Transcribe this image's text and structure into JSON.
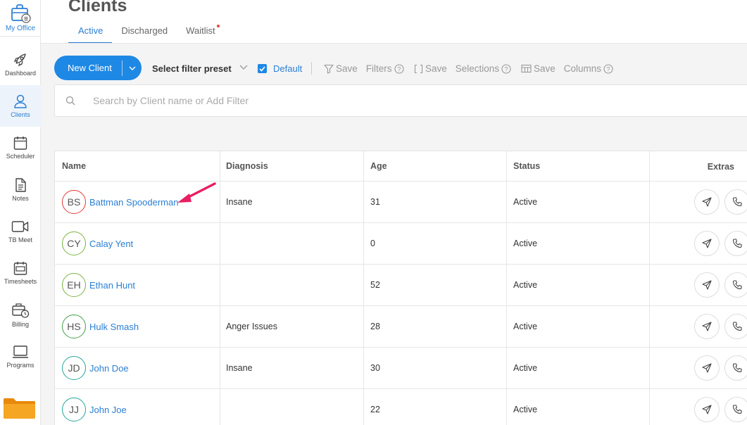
{
  "sidebar": {
    "office_label": "My Office",
    "items": [
      {
        "label": "Dashboard",
        "icon": "rocket-icon"
      },
      {
        "label": "Clients",
        "icon": "user-icon"
      },
      {
        "label": "Scheduler",
        "icon": "calendar-icon"
      },
      {
        "label": "Notes",
        "icon": "notes-icon"
      },
      {
        "label": "TB Meet",
        "icon": "video-icon"
      },
      {
        "label": "Timesheets",
        "icon": "timesheet-icon"
      },
      {
        "label": "Billing",
        "icon": "billing-icon"
      },
      {
        "label": "Programs",
        "icon": "monitor-icon"
      }
    ]
  },
  "header": {
    "title": "Clients",
    "tabs": [
      {
        "label": "Active"
      },
      {
        "label": "Discharged"
      },
      {
        "label": "Waitlist"
      }
    ]
  },
  "toolbar": {
    "new_client_label": "New Client",
    "preset_label": "Select filter preset",
    "default_label": "Default",
    "save_filters": {
      "save": "Save",
      "label": "Filters"
    },
    "save_selections": {
      "save": "Save",
      "label": "Selections"
    },
    "save_columns": {
      "save": "Save",
      "label": "Columns"
    }
  },
  "search": {
    "placeholder": "Search by Client name or Add Filter"
  },
  "table": {
    "headers": {
      "name": "Name",
      "diagnosis": "Diagnosis",
      "age": "Age",
      "status": "Status",
      "extras": "Extras"
    },
    "rows": [
      {
        "initials": "BS",
        "name": "Battman Spooderman",
        "diagnosis": "Insane",
        "age": "31",
        "status": "Active",
        "avatar_color": "#e53935"
      },
      {
        "initials": "CY",
        "name": "Calay Yent",
        "diagnosis": "",
        "age": "0",
        "status": "Active",
        "avatar_color": "#7cb342"
      },
      {
        "initials": "EH",
        "name": "Ethan Hunt",
        "diagnosis": "",
        "age": "52",
        "status": "Active",
        "avatar_color": "#7cb342"
      },
      {
        "initials": "HS",
        "name": "Hulk Smash",
        "diagnosis": "Anger Issues",
        "age": "28",
        "status": "Active",
        "avatar_color": "#43a047"
      },
      {
        "initials": "JD",
        "name": "John Doe",
        "diagnosis": "Insane",
        "age": "30",
        "status": "Active",
        "avatar_color": "#26a69a"
      },
      {
        "initials": "JJ",
        "name": "John Joe",
        "diagnosis": "",
        "age": "22",
        "status": "Active",
        "avatar_color": "#26a69a"
      }
    ]
  },
  "colors": {
    "accent": "#1e88e5",
    "link": "#2b7fd4",
    "annotation_arrow": "#e91e63"
  }
}
